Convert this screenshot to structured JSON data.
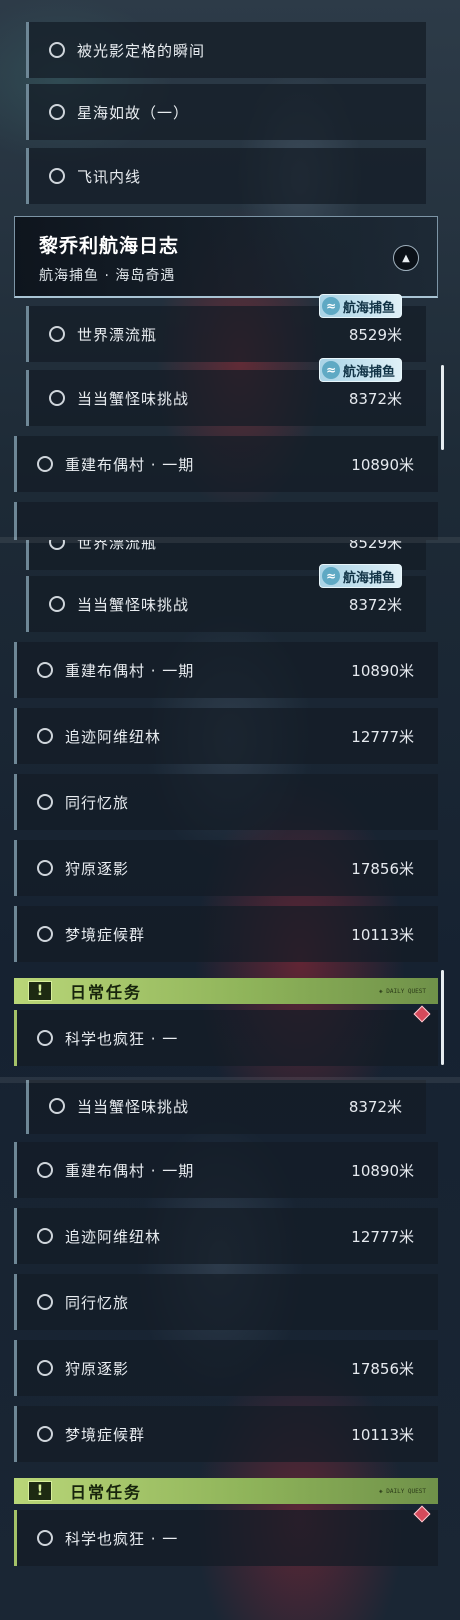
{
  "list": {
    "icon_circle": "circle-outline-icon",
    "sub_items_top": [
      {
        "label": "被光影定格的瞬间"
      },
      {
        "label": "星海如故（一）"
      },
      {
        "label": "飞讯内线"
      }
    ],
    "header": {
      "title": "黎乔利航海日志",
      "subtitle": "航海捕鱼 · 海岛奇遇",
      "collapse_icon": "chevron-up-icon"
    },
    "badge_label": "航海捕鱼",
    "badge_icon": "fish-icon",
    "quests": {
      "world_bottle": {
        "label": "世界漂流瓶",
        "distance": "8529米"
      },
      "crab": {
        "label": "当当蟹怪味挑战",
        "distance": "8372米"
      },
      "rebuild": {
        "label": "重建布偶村 · 一期",
        "distance": "10890米"
      },
      "trace": {
        "label": "追迹阿维纽林",
        "distance": "12777米"
      },
      "memory": {
        "label": "同行忆旅"
      },
      "hunt": {
        "label": "狩原逐影",
        "distance": "17856米"
      },
      "dream": {
        "label": "梦境症候群",
        "distance": "10113米"
      },
      "science": {
        "label": "科学也疯狂 · 一"
      }
    },
    "daily": {
      "title": "日常任务",
      "warn_icon": "exclamation-icon",
      "tag": "◈ DAILY QUEST",
      "marker_icon": "diamond-marker-icon"
    },
    "colors": {
      "accent_daily": "#a4c268",
      "badge": "#a9d3e6",
      "marker": "#d44a5b"
    }
  }
}
